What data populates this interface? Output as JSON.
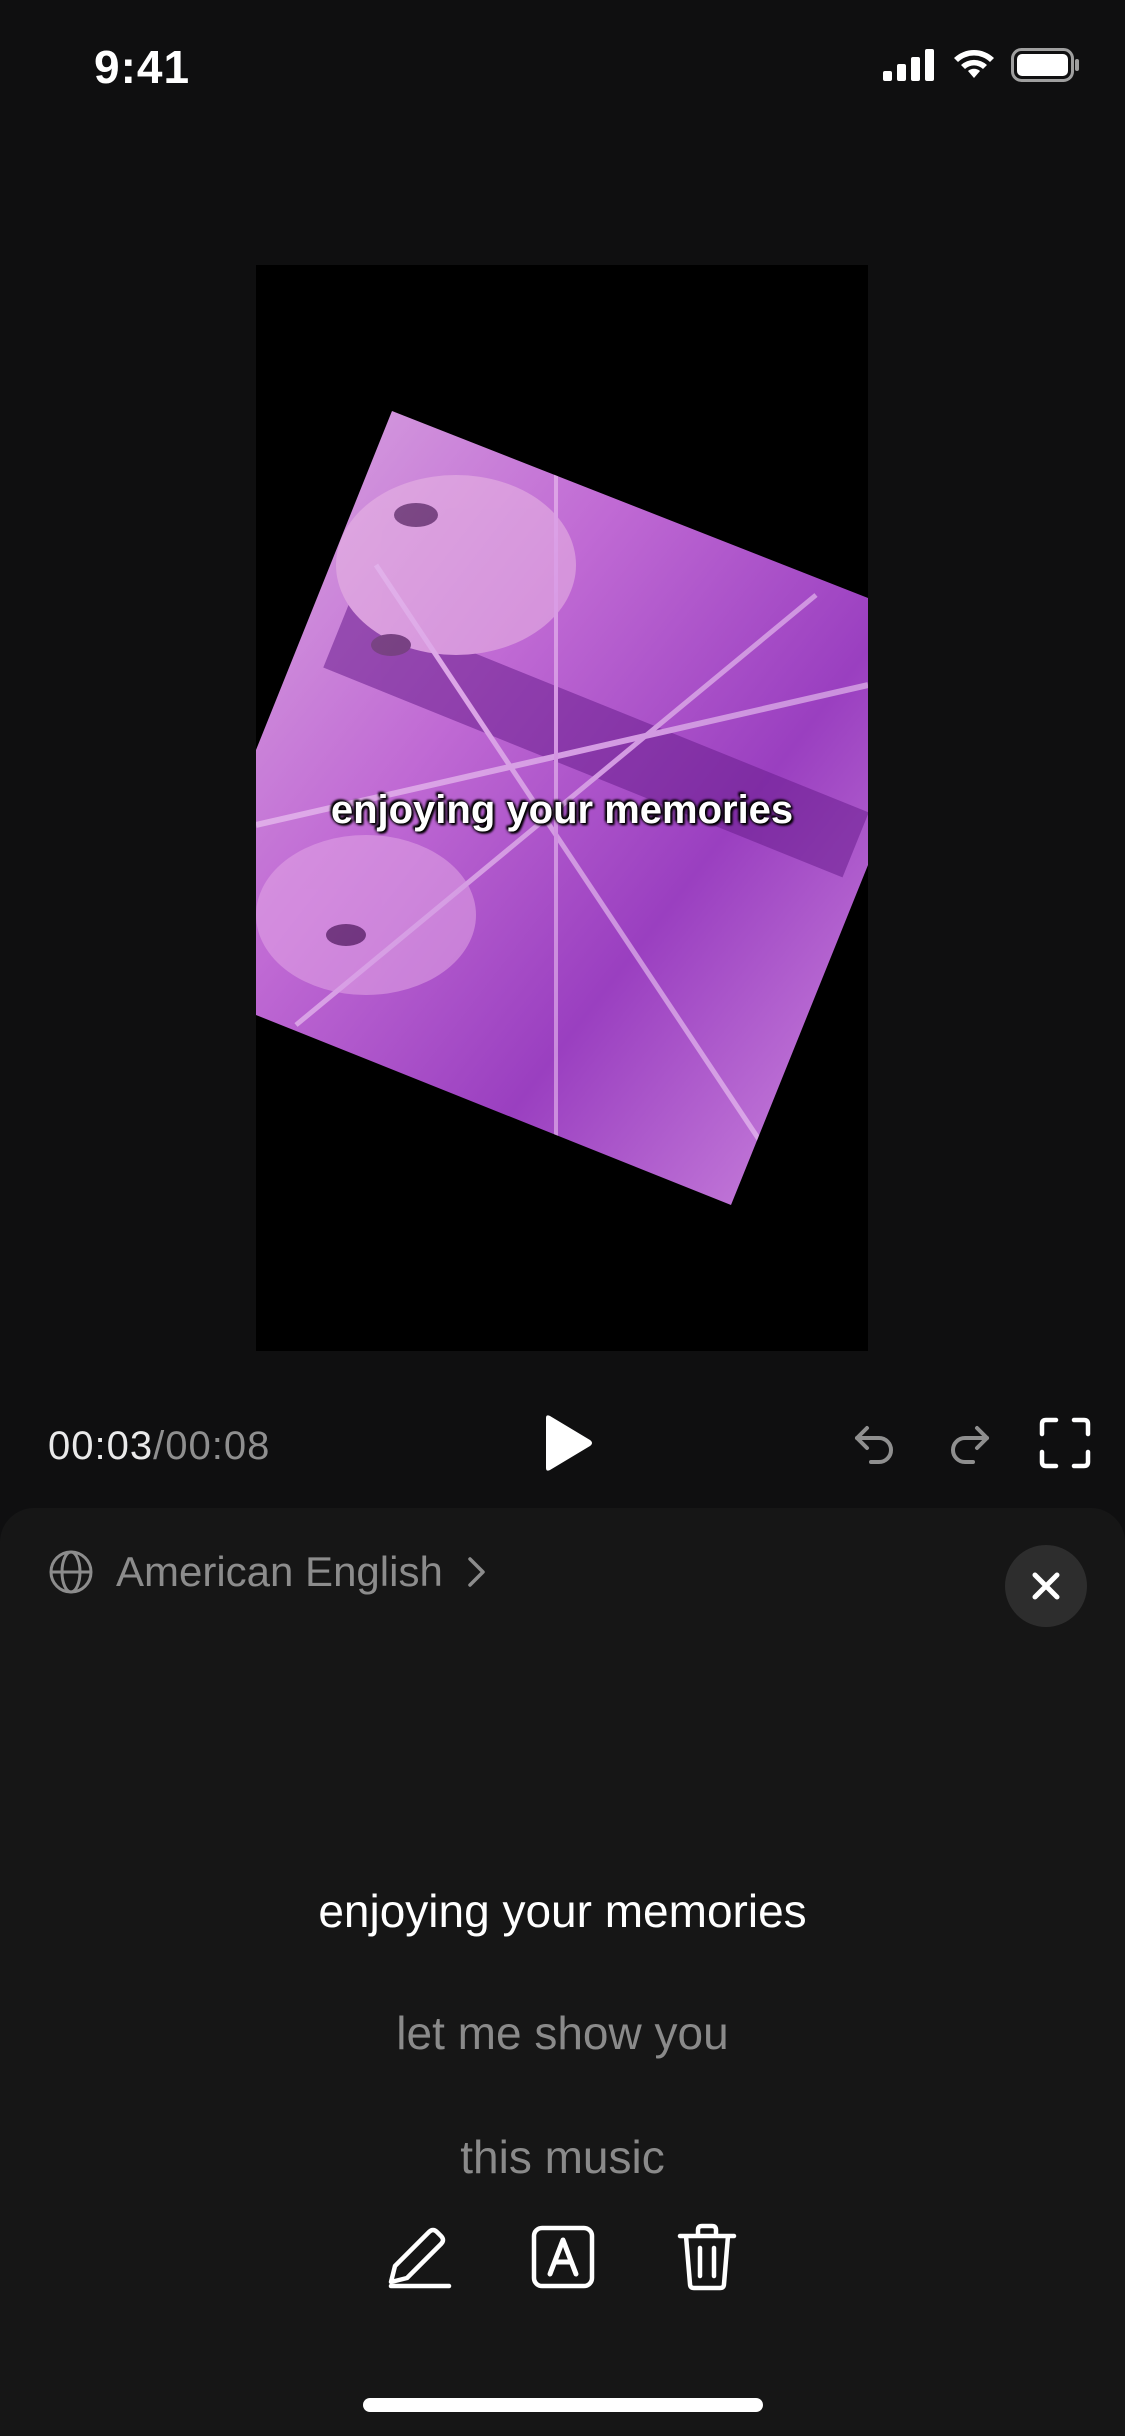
{
  "status_bar": {
    "time": "9:41"
  },
  "preview": {
    "caption": "enjoying your memories"
  },
  "playback": {
    "current": "00:03",
    "separator": "/",
    "duration": "00:08"
  },
  "panel": {
    "language": "American English",
    "lines": [
      {
        "text": "enjoying your memories",
        "active": true
      },
      {
        "text": "let me show you",
        "active": false
      },
      {
        "text": "this music",
        "active": false
      }
    ]
  },
  "icons": [
    "signal-icon",
    "wifi-icon",
    "battery-icon",
    "play-icon",
    "undo-icon",
    "redo-icon",
    "fullscreen-icon",
    "globe-icon",
    "chevron-right-icon",
    "close-icon",
    "edit-icon",
    "text-style-icon",
    "trash-icon"
  ]
}
